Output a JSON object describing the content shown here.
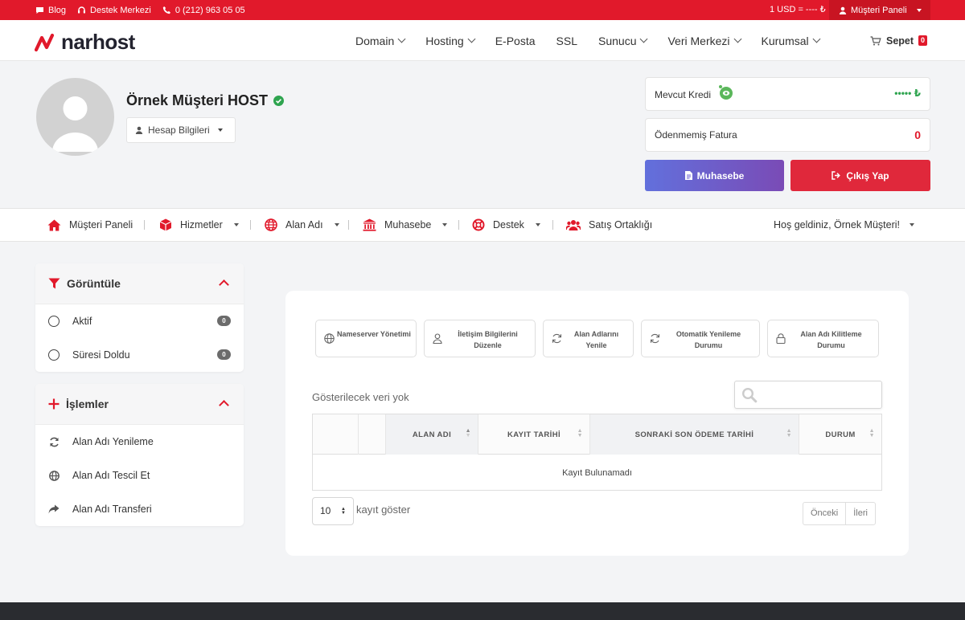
{
  "topbar": {
    "blog": "Blog",
    "support": "Destek Merkezi",
    "phone": "0 (212) 963 05 05",
    "rate": "1 USD = ---- ₺",
    "panel": "Müşteri Paneli"
  },
  "header": {
    "logo": "narhost",
    "nav": [
      "Domain",
      "Hosting",
      "E-Posta",
      "SSL",
      "Sunucu",
      "Veri Merkezi",
      "Kurumsal"
    ],
    "cart_label": "Sepet",
    "cart_count": "0"
  },
  "profile": {
    "name": "Örnek Müşteri HOST",
    "account_button": "Hesap Bilgileri",
    "credit_label": "Mevcut Kredi",
    "credit_value": "••••• ₺",
    "unpaid_label": "Ödenmemiş Fatura",
    "unpaid_value": "0",
    "accounting_button": "Muhasebe",
    "logout_button": "Çıkış Yap"
  },
  "menu": {
    "items": [
      "Müşteri Paneli",
      "Hizmetler",
      "Alan Adı",
      "Muhasebe",
      "Destek",
      "Satış Ortaklığı"
    ],
    "welcome": "Hoş geldiniz, Örnek Müşteri!"
  },
  "sidebar": {
    "filter_title": "Görüntüle",
    "filters": [
      {
        "label": "Aktif",
        "count": "0"
      },
      {
        "label": "Süresi Doldu",
        "count": "0"
      }
    ],
    "actions_title": "İşlemler",
    "actions": [
      "Alan Adı Yenileme",
      "Alan Adı Tescil Et",
      "Alan Adı Transferi"
    ]
  },
  "actions": {
    "nameserver": "Nameserver Yönetimi",
    "contact": "İletişim Bilgilerini Düzenle",
    "renew": "Alan Adlarını Yenile",
    "autorenew": "Otomatik Yenileme Durumu",
    "lock": "Alan Adı Kilitleme Durumu"
  },
  "table": {
    "no_data": "Gösterilecek veri yok",
    "columns": [
      "ALAN ADI",
      "KAYIT TARİHİ",
      "SONRAKİ SON ÖDEME TARİHİ",
      "DURUM"
    ],
    "empty": "Kayıt Bulunamadı",
    "length_value": "10",
    "length_label": "kayıt göster",
    "prev": "Önceki",
    "next": "İleri"
  },
  "colors": {
    "brand_red": "#e1192b",
    "accounting_gradient": [
      "#6270dc",
      "#7a4bb6"
    ],
    "logout_red": "#e0283b",
    "credit_green": "#2ea44f"
  }
}
